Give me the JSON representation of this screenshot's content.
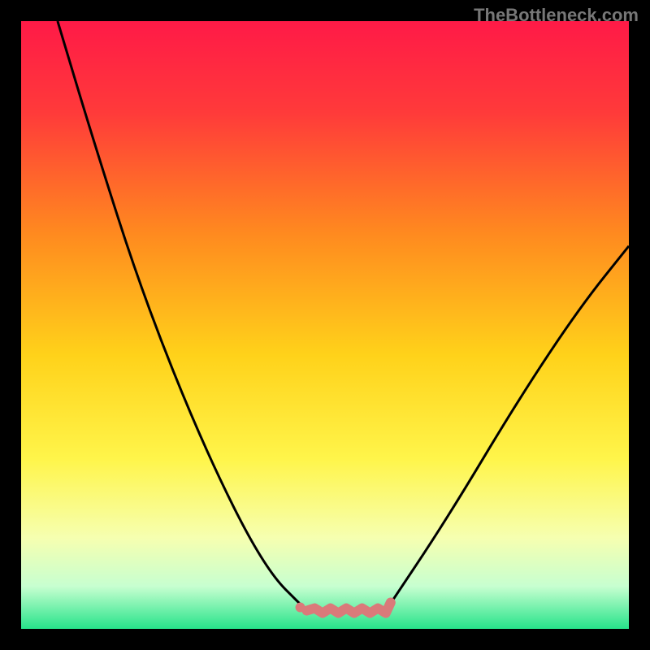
{
  "watermark": "TheBottleneck.com",
  "chart_data": {
    "type": "line",
    "title": "",
    "xlabel": "",
    "ylabel": "",
    "xlim": [
      0,
      100
    ],
    "ylim": [
      0,
      100
    ],
    "background_gradient_stops": [
      {
        "pct": 0,
        "color": "#ff1a47"
      },
      {
        "pct": 15,
        "color": "#ff3a3a"
      },
      {
        "pct": 35,
        "color": "#ff8a1f"
      },
      {
        "pct": 55,
        "color": "#ffd21a"
      },
      {
        "pct": 72,
        "color": "#fff54a"
      },
      {
        "pct": 85,
        "color": "#f6ffb0"
      },
      {
        "pct": 93,
        "color": "#c7ffd0"
      },
      {
        "pct": 100,
        "color": "#26e38a"
      }
    ],
    "series": [
      {
        "name": "left-curve",
        "values": [
          {
            "x": 6,
            "y": 100
          },
          {
            "x": 12,
            "y": 80
          },
          {
            "x": 20,
            "y": 55
          },
          {
            "x": 30,
            "y": 30
          },
          {
            "x": 40,
            "y": 10
          },
          {
            "x": 47,
            "y": 3
          }
        ]
      },
      {
        "name": "right-curve",
        "values": [
          {
            "x": 60,
            "y": 3
          },
          {
            "x": 70,
            "y": 18
          },
          {
            "x": 82,
            "y": 38
          },
          {
            "x": 92,
            "y": 53
          },
          {
            "x": 100,
            "y": 63
          }
        ]
      }
    ],
    "optimal_zone": {
      "name": "bottleneck-optimal",
      "color": "#da7a7a",
      "x_range": [
        47,
        60
      ],
      "y": 3
    }
  }
}
